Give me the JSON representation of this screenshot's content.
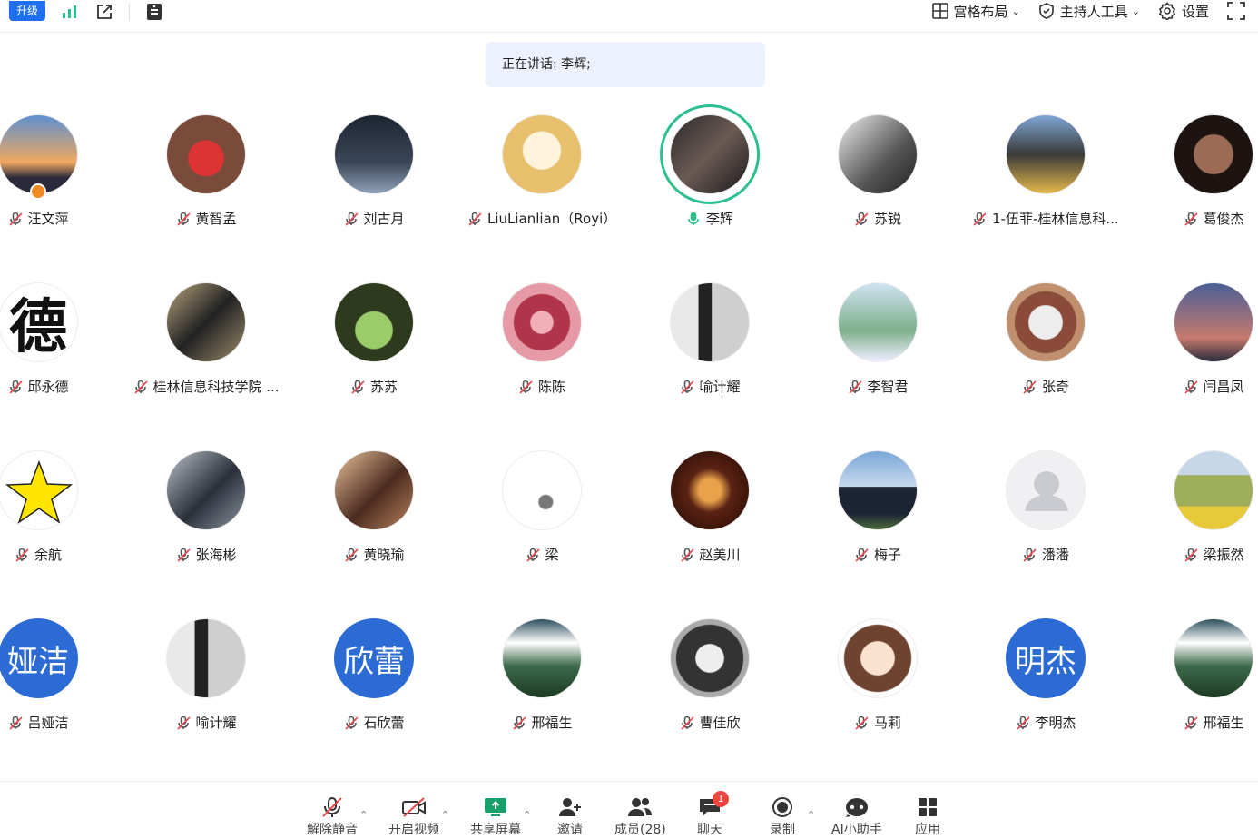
{
  "topbar": {
    "upgrade_label": "升级",
    "layout_label": "宫格布局",
    "host_tools_label": "主持人工具",
    "settings_label": "设置"
  },
  "speaking": {
    "text": "正在讲话: 李辉;"
  },
  "participants": [
    {
      "name": "汪文萍",
      "avatar": "sunset"
    },
    {
      "name": "黄智孟",
      "avatar": "red-carving"
    },
    {
      "name": "刘古月",
      "avatar": "stage"
    },
    {
      "name": "LiuLianlian（Royi）",
      "avatar": "cartoon-girl"
    },
    {
      "name": "李辉",
      "avatar": "portrait",
      "speaking": true
    },
    {
      "name": "苏锐",
      "avatar": "bw-person"
    },
    {
      "name": "1-伍菲-桂林信息科...",
      "avatar": "icecream"
    },
    {
      "name": "葛俊杰",
      "avatar": "elder-figure"
    },
    {
      "name": "邱永德",
      "avatar": "char-de"
    },
    {
      "name": "桂林信息科技学院 ...",
      "avatar": "motorcycle"
    },
    {
      "name": "苏苏",
      "avatar": "plants"
    },
    {
      "name": "陈陈",
      "avatar": "pattern"
    },
    {
      "name": "喻计耀",
      "avatar": "wall"
    },
    {
      "name": "李智君",
      "avatar": "flowers"
    },
    {
      "name": "张奇",
      "avatar": "plate"
    },
    {
      "name": "闫昌凤",
      "avatar": "evening-sky"
    },
    {
      "name": "余航",
      "avatar": "star"
    },
    {
      "name": "张海彬",
      "avatar": "man"
    },
    {
      "name": "黄晓瑜",
      "avatar": "woman"
    },
    {
      "name": "梁",
      "avatar": "sketch"
    },
    {
      "name": "赵美川",
      "avatar": "candles"
    },
    {
      "name": "梅子",
      "avatar": "girl-back"
    },
    {
      "name": "潘潘",
      "avatar": "default"
    },
    {
      "name": "梁振然",
      "avatar": "field"
    },
    {
      "name": "吕娅洁",
      "avatar_text": "娅洁"
    },
    {
      "name": "喻计耀",
      "avatar": "wall"
    },
    {
      "name": "石欣蕾",
      "avatar_text": "欣蕾"
    },
    {
      "name": "邢福生",
      "avatar": "mountain"
    },
    {
      "name": "曹佳欣",
      "avatar": "monkey"
    },
    {
      "name": "马莉",
      "avatar": "anime-girl"
    },
    {
      "name": "李明杰",
      "avatar_text": "明杰"
    },
    {
      "name": "邢福生",
      "avatar": "mountain"
    }
  ],
  "bottombar": {
    "unmute_label": "解除静音",
    "video_label": "开启视频",
    "share_label": "共享屏幕",
    "invite_label": "邀请",
    "members_label": "成员(28)",
    "chat_label": "聊天",
    "chat_badge": "1",
    "record_label": "录制",
    "ai_label": "AI小助手",
    "apps_label": "应用"
  },
  "colors": {
    "accent": "#1f6ff2",
    "speaking_ring": "#2ec08a",
    "badge": "#f0443f",
    "text_avatar": "#2b6bd3"
  }
}
